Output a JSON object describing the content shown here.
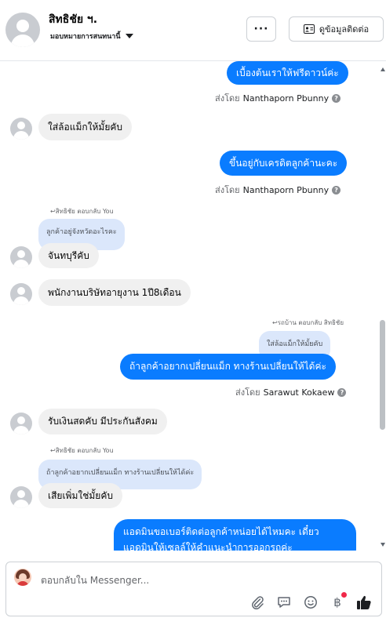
{
  "header": {
    "contact_name": "สิทธิชัย ฯ.",
    "assign_label": "มอบหมายการสนทนานี้",
    "more_label": "···",
    "view_contact_label": "ดูข้อมูลติดต่อ"
  },
  "messages": {
    "m1": "เบื้องต้นเราให้ฟรีดาวน์ค่ะ",
    "m1_sent_prefix": "ส่งโดย",
    "m1_sender": "Nanthaporn Pbunny",
    "m2": "ใส่ล้อแม็กให้มั้ยคับ",
    "m3": "ขึ้นอยู่กับเครดิตลูกค้านะคะ",
    "m3_sent_prefix": "ส่งโดย",
    "m3_sender": "Nanthaporn Pbunny",
    "m4_reply_label": "สิทธิชัย ตอบกลับ You",
    "m4_quote": "ลูกค้าอยู่จังหวัดอะไรคะ",
    "m4": "จันทบุรีคับ",
    "m5": "พนักงานบริษัทอายุงาน 1ปี8เดือน",
    "m6_reply_label": "รถบ้าน ตอบกลับ สิทธิชัย",
    "m6_quote": "ใส่ล้อแม็กให้มั้ยคับ",
    "m6": "ถ้าลูกค้าอยากเปลี่ยนแม็ก ทางร้านเปลี่ยนให้ได้ค่ะ",
    "m6_sent_prefix": "ส่งโดย",
    "m6_sender": "Sarawut Kokaew",
    "m7": "รับเงินสดคับ มีประกันสังคม",
    "m8_reply_label": "สิทธิชัย ตอบกลับ You",
    "m8_quote": "ถ้าลูกค้าอยากเปลี่ยนแม็ก ทางร้านเปลี่ยนให้ได้ค่ะ",
    "m8": "เสียเพิ่มใช่มั้ยคับ",
    "m9_line1": "แอดมินขอเบอร์ติดต่อลูกค้าหน่อยได้ไหมคะ เดี๋ยว",
    "m9_line2": "แอดมินให้เซลล์ให้คำแนะนำการออกรถค่ะ"
  },
  "composer": {
    "placeholder": "ตอบกลับใน Messenger...",
    "icons": [
      "paperclip-icon",
      "quick-reply-icon",
      "emoji-icon",
      "baht-icon",
      "like-icon"
    ]
  },
  "colors": {
    "outgoing_bubble": "#0a7cff",
    "incoming_bubble": "#f0f0f0",
    "quote_bubble": "#dbe7fb",
    "notification_dot": "#f02849"
  }
}
